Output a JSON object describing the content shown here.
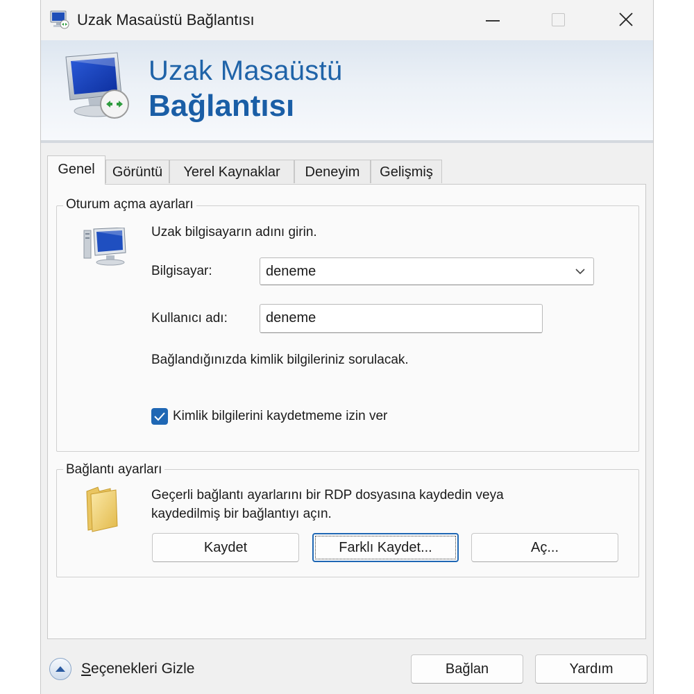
{
  "window": {
    "title": "Uzak Masaüstü Bağlantısı",
    "controls": {
      "minimize": "minimize",
      "maximize": "maximize",
      "close": "close"
    }
  },
  "banner": {
    "line1": "Uzak Masaüstü",
    "line2": "Bağlantısı",
    "icon": "remote-desktop-icon"
  },
  "tabs": [
    {
      "label": "Genel",
      "active": true
    },
    {
      "label": "Görüntü",
      "active": false
    },
    {
      "label": "Yerel Kaynaklar",
      "active": false
    },
    {
      "label": "Deneyim",
      "active": false
    },
    {
      "label": "Gelişmiş",
      "active": false
    }
  ],
  "logon": {
    "group_title": "Oturum açma ayarları",
    "prompt": "Uzak bilgisayarın adını girin.",
    "computer_label": "Bilgisayar:",
    "computer_value": "deneme",
    "username_label": "Kullanıcı adı:",
    "username_value": "deneme",
    "info": "Bağlandığınızda kimlik bilgileriniz sorulacak.",
    "save_credentials_label": "Kimlik bilgilerini kaydetmeme izin ver",
    "save_credentials_checked": true,
    "icon": "computer-icon"
  },
  "connection": {
    "group_title": "Bağlantı ayarları",
    "description_line1": "Geçerli bağlantı ayarlarını bir RDP dosyasına kaydedin veya",
    "description_line2": "kaydedilmiş bir bağlantıyı açın.",
    "save_button": "Kaydet",
    "save_as_button": "Farklı Kaydet...",
    "open_button": "Aç...",
    "icon": "folder-icon"
  },
  "footer": {
    "hide_options_label": "Seçenekleri Gizle",
    "connect_button": "Bağlan",
    "help_button": "Yardım"
  },
  "colors": {
    "accent": "#1f67b4",
    "banner_text": "#1f63a8"
  }
}
